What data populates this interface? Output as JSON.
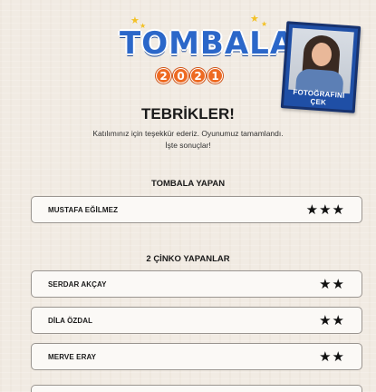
{
  "logo": {
    "title": "TOMBALA",
    "year_digits": [
      "2",
      "0",
      "2",
      "1"
    ]
  },
  "photo": {
    "caption": "FOTOĞRAFINI ÇEK"
  },
  "heading": "TEBRİKLER!",
  "thanks_line1": "Katılımınız için teşekkür ederiz. Oyunumuz tamamlandı.",
  "thanks_line2": "İşte sonuçlar!",
  "tombala_section": {
    "title": "TOMBALA YAPAN",
    "rows": [
      {
        "name": "MUSTAFA EĞİLMEZ",
        "stars": "★★★"
      }
    ]
  },
  "cinko_section": {
    "title": "2 ÇİNKO YAPANLAR",
    "rows": [
      {
        "name": "SERDAR AKÇAY",
        "stars": "★★"
      },
      {
        "name": "DİLA ÖZDAL",
        "stars": "★★"
      },
      {
        "name": "MERVE ERAY",
        "stars": "★★"
      }
    ]
  },
  "colors": {
    "logo_blue": "#2b67c9",
    "year_orange": "#ee6a22",
    "frame_blue": "#1f4fa6"
  }
}
